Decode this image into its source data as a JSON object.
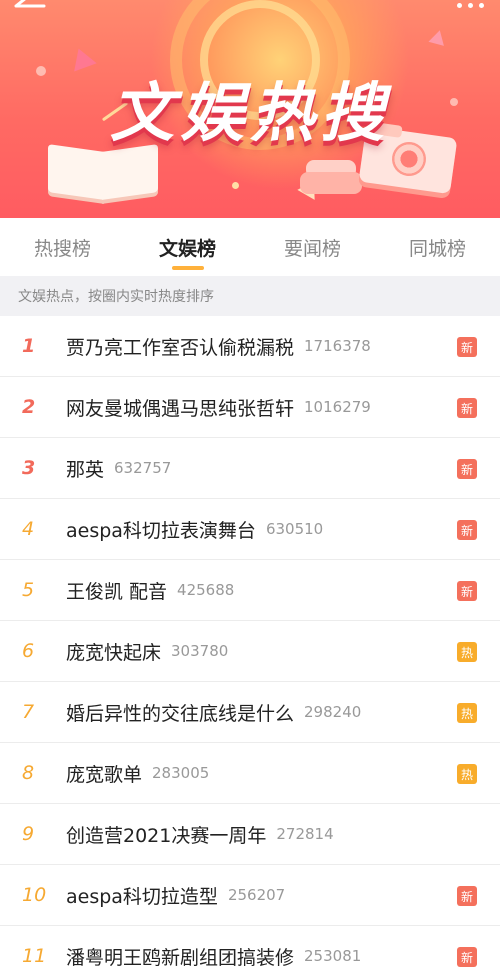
{
  "header": {
    "title": "文娱热搜",
    "back_icon": "back-arrow-icon",
    "more_icon": "more-dots-icon"
  },
  "tabs": [
    {
      "label": "热搜榜",
      "active": false
    },
    {
      "label": "文娱榜",
      "active": true
    },
    {
      "label": "要闻榜",
      "active": false
    },
    {
      "label": "同城榜",
      "active": false
    }
  ],
  "subtitle": "文娱热点，按圈内实时热度排序",
  "colors": {
    "new_badge": "#f4705c",
    "hot_badge": "#f8ac2b",
    "rank_top": "#f26a5b",
    "rank_mid": "#f6a932",
    "active_tab_underline": "#ffb13b"
  },
  "list": [
    {
      "rank": "1",
      "title": "贾乃亮工作室否认偷税漏税",
      "count": "1716378",
      "badge": "新",
      "badge_type": "new"
    },
    {
      "rank": "2",
      "title": "网友曼城偶遇马思纯张哲轩",
      "count": "1016279",
      "badge": "新",
      "badge_type": "new"
    },
    {
      "rank": "3",
      "title": "那英",
      "count": "632757",
      "badge": "新",
      "badge_type": "new"
    },
    {
      "rank": "4",
      "title": "aespa科切拉表演舞台",
      "count": "630510",
      "badge": "新",
      "badge_type": "new"
    },
    {
      "rank": "5",
      "title": "王俊凯  配音",
      "count": "425688",
      "badge": "新",
      "badge_type": "new"
    },
    {
      "rank": "6",
      "title": "庞宽快起床",
      "count": "303780",
      "badge": "热",
      "badge_type": "hot"
    },
    {
      "rank": "7",
      "title": "婚后异性的交往底线是什么",
      "count": "298240",
      "badge": "热",
      "badge_type": "hot"
    },
    {
      "rank": "8",
      "title": "庞宽歌单",
      "count": "283005",
      "badge": "热",
      "badge_type": "hot"
    },
    {
      "rank": "9",
      "title": "创造营2021决赛一周年",
      "count": "272814",
      "badge": "",
      "badge_type": "none"
    },
    {
      "rank": "10",
      "title": "aespa科切拉造型",
      "count": "256207",
      "badge": "新",
      "badge_type": "new"
    },
    {
      "rank": "11",
      "title": "潘粤明王鸥新剧组团搞装修",
      "count": "253081",
      "badge": "新",
      "badge_type": "new"
    }
  ]
}
